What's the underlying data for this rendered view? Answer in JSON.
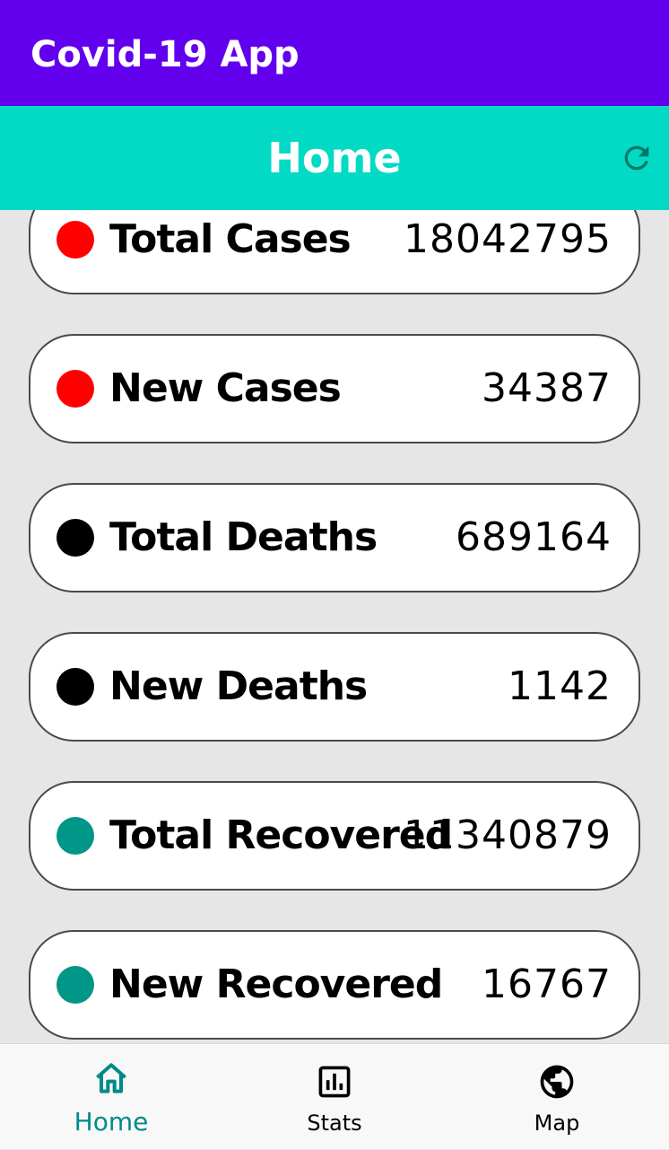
{
  "app_bar": {
    "title": "Covid-19 App",
    "background": "#6200ee"
  },
  "header": {
    "title": "Home",
    "background": "#03dac5",
    "refresh_icon": "refresh-icon"
  },
  "stats": [
    {
      "label": "Total Cases",
      "value": "18042795",
      "dot_color": "#ff0000"
    },
    {
      "label": "New Cases",
      "value": "34387",
      "dot_color": "#ff0000"
    },
    {
      "label": "Total Deaths",
      "value": "689164",
      "dot_color": "#000000"
    },
    {
      "label": "New Deaths",
      "value": "1142",
      "dot_color": "#000000"
    },
    {
      "label": "Total Recovered",
      "value": "11340879",
      "dot_color": "#009688"
    },
    {
      "label": "New Recovered",
      "value": "16767",
      "dot_color": "#009688"
    }
  ],
  "bottom_nav": {
    "items": [
      {
        "label": "Home",
        "icon": "home-icon",
        "active": true
      },
      {
        "label": "Stats",
        "icon": "bar-chart-icon",
        "active": false
      },
      {
        "label": "Map",
        "icon": "globe-icon",
        "active": false
      }
    ],
    "active_color": "#008a8a",
    "inactive_color": "#000000"
  }
}
